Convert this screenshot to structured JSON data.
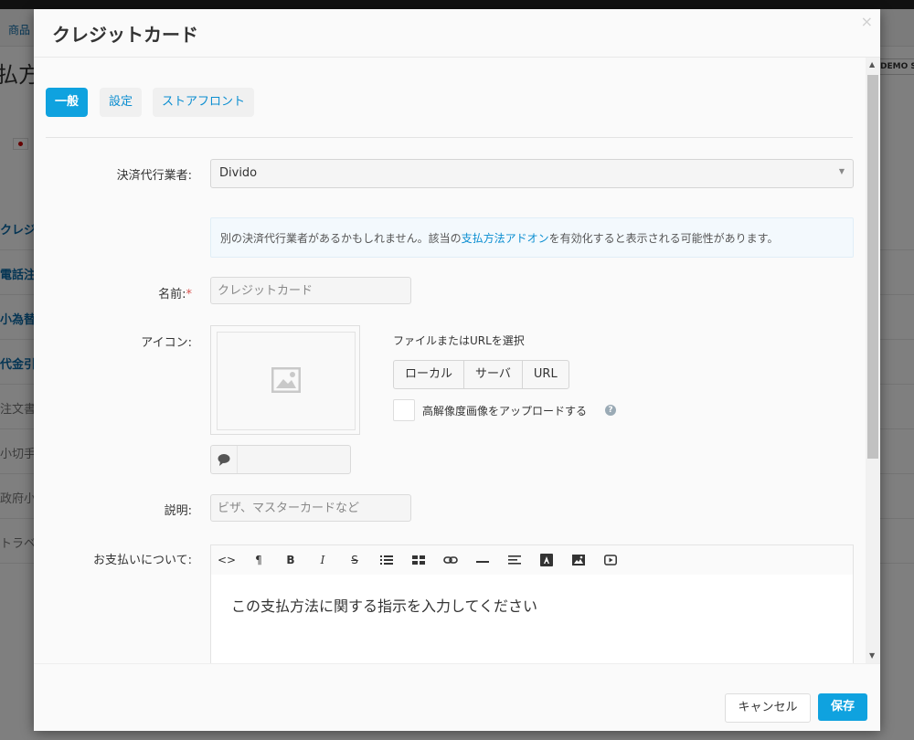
{
  "background": {
    "nav_item": "商品",
    "page_title": "払方",
    "demo_badge": "DEMO S",
    "list_items": [
      "クレジ",
      "電話注",
      "小為替",
      "代金引",
      "注文書",
      "小切手",
      "政府小",
      "トラベ"
    ]
  },
  "modal": {
    "title": "クレジットカード",
    "close_glyph": "×",
    "tabs": [
      "一般",
      "設定",
      "ストアフロント"
    ],
    "active_tab": "一般",
    "processor": {
      "label": "決済代行業者:",
      "value": "Divido"
    },
    "notice": {
      "text_before": "別の決済代行業者があるかもしれません。該当の",
      "link": "支払方法アドオン",
      "text_after": "を有効化すると表示される可能性があります。"
    },
    "name": {
      "label": "名前:",
      "required_mark": "*",
      "placeholder": "クレジットカード"
    },
    "icon": {
      "label": "アイコン:",
      "file_caption": "ファイルまたはURLを選択",
      "sources": [
        "ローカル",
        "サーバ",
        "URL"
      ],
      "hires_label": "高解像度画像をアップロードする",
      "help_glyph": "?"
    },
    "description": {
      "label": "説明:",
      "placeholder": "ビザ、マスターカードなど"
    },
    "instructions": {
      "label": "お支払いについて:",
      "toolbar_icons": [
        "code-view",
        "paragraph",
        "bold",
        "italic",
        "strikethrough",
        "unordered-list",
        "table",
        "link",
        "horizontal-rule",
        "align",
        "font-color",
        "image",
        "video"
      ],
      "text": "この支払方法に関する指示を入力してください"
    },
    "footer": {
      "cancel": "キャンセル",
      "save": "保存"
    }
  },
  "colors": {
    "accent": "#0fa2df",
    "link": "#0b8ed1",
    "required": "#d9534f"
  }
}
